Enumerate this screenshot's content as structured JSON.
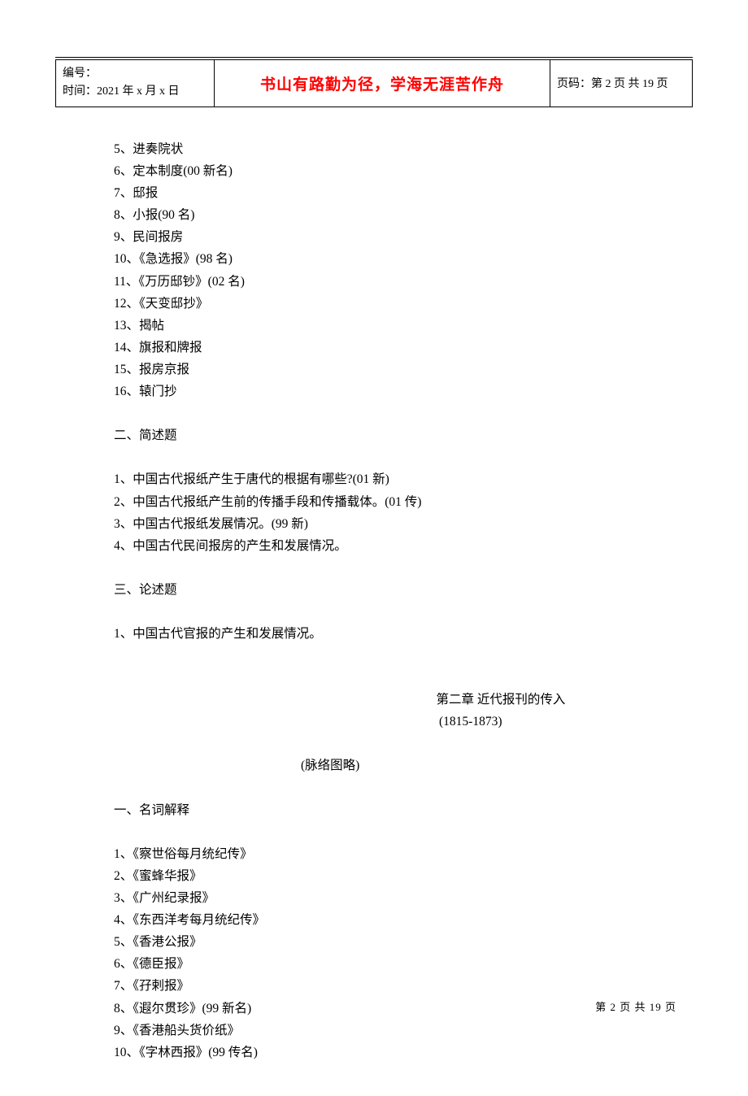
{
  "header": {
    "id_label": "编号：",
    "time_label": "时间：",
    "time_value": "2021 年 x 月 x 日",
    "motto": "书山有路勤为径，学海无涯苦作舟",
    "page_label": "页码：",
    "page_value": "第 2 页 共 19 页"
  },
  "list1": [
    "5、进奏院状",
    "6、定本制度(00 新名)",
    "7、邸报",
    "8、小报(90 名)",
    "9、民间报房",
    "10、《急选报》(98 名)",
    "11、《万历邸钞》(02 名)",
    "12、《天变邸抄》",
    "13、揭帖",
    "14、旗报和牌报",
    "15、报房京报",
    "16、辕门抄"
  ],
  "section2_title": "二、简述题",
  "list2": [
    "1、中国古代报纸产生于唐代的根据有哪些?(01 新)",
    "2、中国古代报纸产生前的传播手段和传播载体。(01 传)",
    "3、中国古代报纸发展情况。(99 新)",
    "4、中国古代民间报房的产生和发展情况。"
  ],
  "section3_title": "三、论述题",
  "list3": [
    "1、中国古代官报的产生和发展情况。"
  ],
  "chapter": {
    "title": "第二章  近代报刊的传入",
    "date": "(1815-1873)",
    "outline": "(脉络图略)"
  },
  "section4_title": "一、名词解释",
  "list4": [
    "1、《察世俗每月统纪传》",
    "2、《蜜蜂华报》",
    "3、《广州纪录报》",
    "4、《东西洋考每月统纪传》",
    "5、《香港公报》",
    "6、《德臣报》",
    "7、《孖剌报》",
    "8、《遐尔贯珍》(99 新名)",
    "9、《香港船头货价纸》",
    "10、《字林西报》(99 传名)"
  ],
  "footer": "第 2 页 共 19 页"
}
